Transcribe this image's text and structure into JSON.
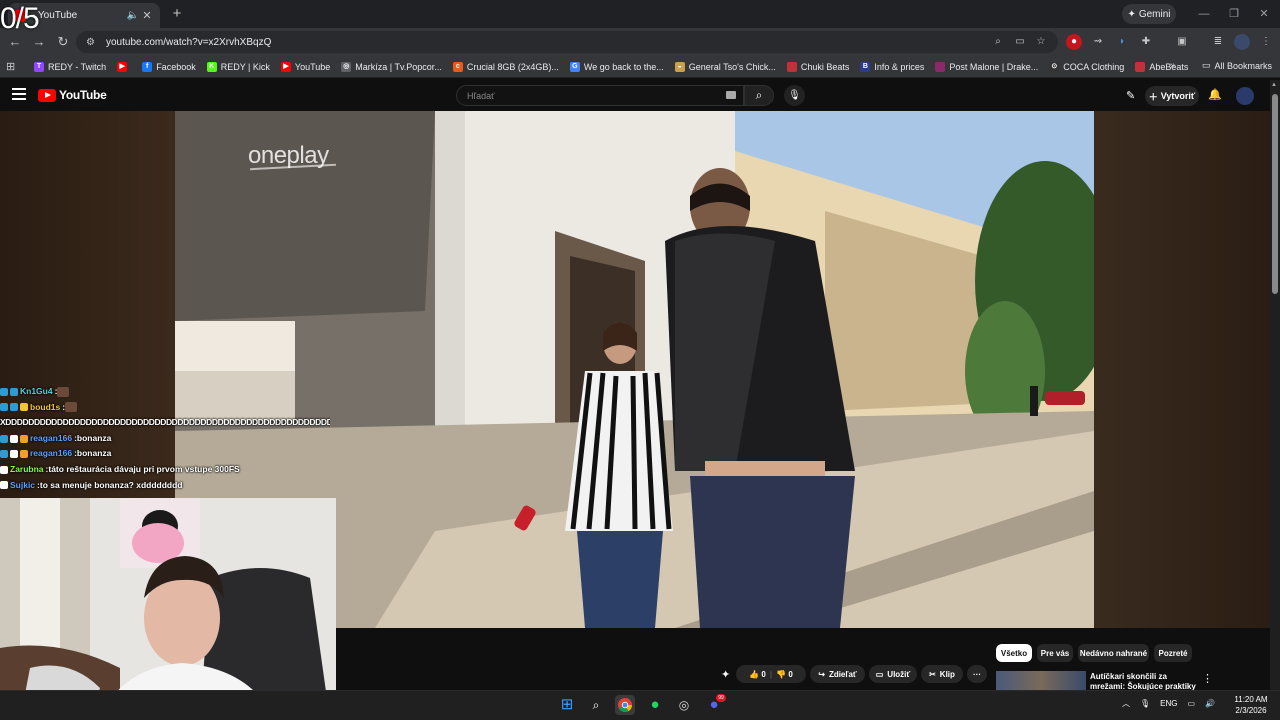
{
  "overlay": {
    "score": "0/5"
  },
  "browser": {
    "tab_title": "- YouTube",
    "url": "youtube.com/watch?v=x2XrvhXBqzQ",
    "gemini_label": "Gemini",
    "bookmarks": [
      {
        "label": "REDY - Twitch",
        "color": "#9146ff",
        "glyph": "T"
      },
      {
        "label": "",
        "color": "#ff0000",
        "glyph": "▶"
      },
      {
        "label": "Facebook",
        "color": "#1877f2",
        "glyph": "f"
      },
      {
        "label": "REDY | Kick",
        "color": "#53fc18",
        "glyph": "K"
      },
      {
        "label": "YouTube",
        "color": "#ff0000",
        "glyph": "▶"
      },
      {
        "label": "Markíza | Tv.Popcor...",
        "color": "#5f6368",
        "glyph": "◎"
      },
      {
        "label": "Crucial 8GB (2x4GB)...",
        "color": "#e8591a",
        "glyph": "c"
      },
      {
        "label": "We go back to the...",
        "color": "#4285f4",
        "glyph": "G"
      },
      {
        "label": "General Tso's Chick...",
        "color": "#c8a050",
        "glyph": "◒"
      },
      {
        "label": "Chuki Beats",
        "color": "#c0323a",
        "glyph": ""
      },
      {
        "label": "Info & prices",
        "color": "#2d3b8f",
        "glyph": "B"
      },
      {
        "label": "Post Malone | Drake...",
        "color": "#8a2a6a",
        "glyph": ""
      },
      {
        "label": "COCA Clothing",
        "color": "#333333",
        "glyph": "⊙"
      },
      {
        "label": "AbeBeats",
        "color": "#c0323a",
        "glyph": ""
      }
    ],
    "more_bookmarks": "»",
    "all_bookmarks": "All Bookmarks"
  },
  "youtube": {
    "logo_text": "YouTube",
    "search_placeholder": "Hľadať",
    "create_label": "Vytvoriť",
    "watermark": "oneplay",
    "chips": [
      "Všetko",
      "Pre vás",
      "Nedávno nahrané",
      "Pozreté"
    ],
    "actions": {
      "likes": "0",
      "dislikes": "0",
      "share": "Zdieľať",
      "save": "Uložiť",
      "clip": "Klip"
    },
    "recommended_title": "Autíčkari skončili za mrežami: Šokujúce praktiky na internete"
  },
  "chat": [
    {
      "user": "Kn1Gu4",
      "text": "",
      "color": "#4dd0e1",
      "badges": [
        "#2d9bd4",
        "#2d9bd4"
      ]
    },
    {
      "user": "boud1s",
      "text": "",
      "color": "#f4c430",
      "badges": [
        "#2d9bd4",
        "#2d9bd4",
        "#f4c430"
      ]
    },
    {
      "user": "",
      "text": "XDDDDDDDDDDDDDDDDDDDDDDDDDDDDDDDDDDDDDDDDDDDDDDDDDDDDDDDDDD",
      "color": "#ffffff",
      "badges": []
    },
    {
      "user": "reagan166",
      "text": "bonanza",
      "color": "#5aa0ff",
      "badges": [
        "#2d9bd4",
        "#ffffff",
        "#f4a020"
      ]
    },
    {
      "user": "reagan166",
      "text": "bonanza",
      "color": "#5aa0ff",
      "badges": [
        "#2d9bd4",
        "#ffffff",
        "#f4a020"
      ]
    },
    {
      "user": "Zarubna",
      "text": "táto reštaurácia dávaju pri prvom vstupe 300FS",
      "color": "#7fff3a",
      "badges": [
        "#ffffff"
      ]
    },
    {
      "user": "Sujkic",
      "text": "to sa menuje bonanza? xdddddddd",
      "color": "#5aa0ff",
      "badges": [
        "#ffffff"
      ]
    }
  ],
  "taskbar": {
    "language": "ENG",
    "time": "11:20 AM",
    "date": "2/3/2026",
    "discord_badge": "99"
  }
}
